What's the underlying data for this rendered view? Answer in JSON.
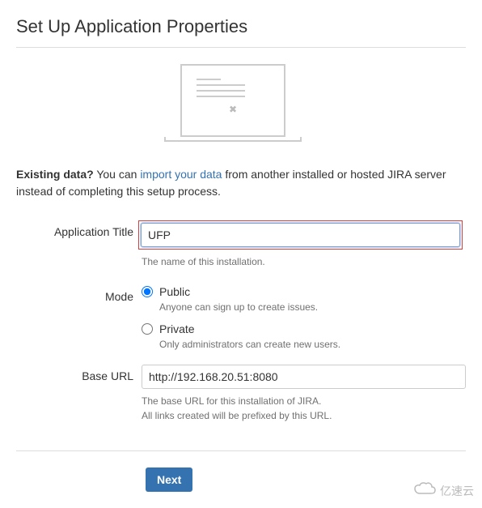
{
  "title": "Set Up Application Properties",
  "existing": {
    "prefix": "Existing data?",
    "mid1": " You can ",
    "link": "import your data",
    "mid2": " from another installed or hosted JIRA server instead of completing this setup process."
  },
  "form": {
    "appTitle": {
      "label": "Application Title",
      "value": "UFP",
      "hint": "The name of this installation."
    },
    "mode": {
      "label": "Mode",
      "public": {
        "label": "Public",
        "hint": "Anyone can sign up to create issues.",
        "checked": true
      },
      "private": {
        "label": "Private",
        "hint": "Only administrators can create new users.",
        "checked": false
      }
    },
    "baseUrl": {
      "label": "Base URL",
      "value": "http://192.168.20.51:8080",
      "hint1": "The base URL for this installation of JIRA.",
      "hint2": "All links created will be prefixed by this URL."
    }
  },
  "buttons": {
    "next": "Next"
  },
  "watermark": "亿速云"
}
